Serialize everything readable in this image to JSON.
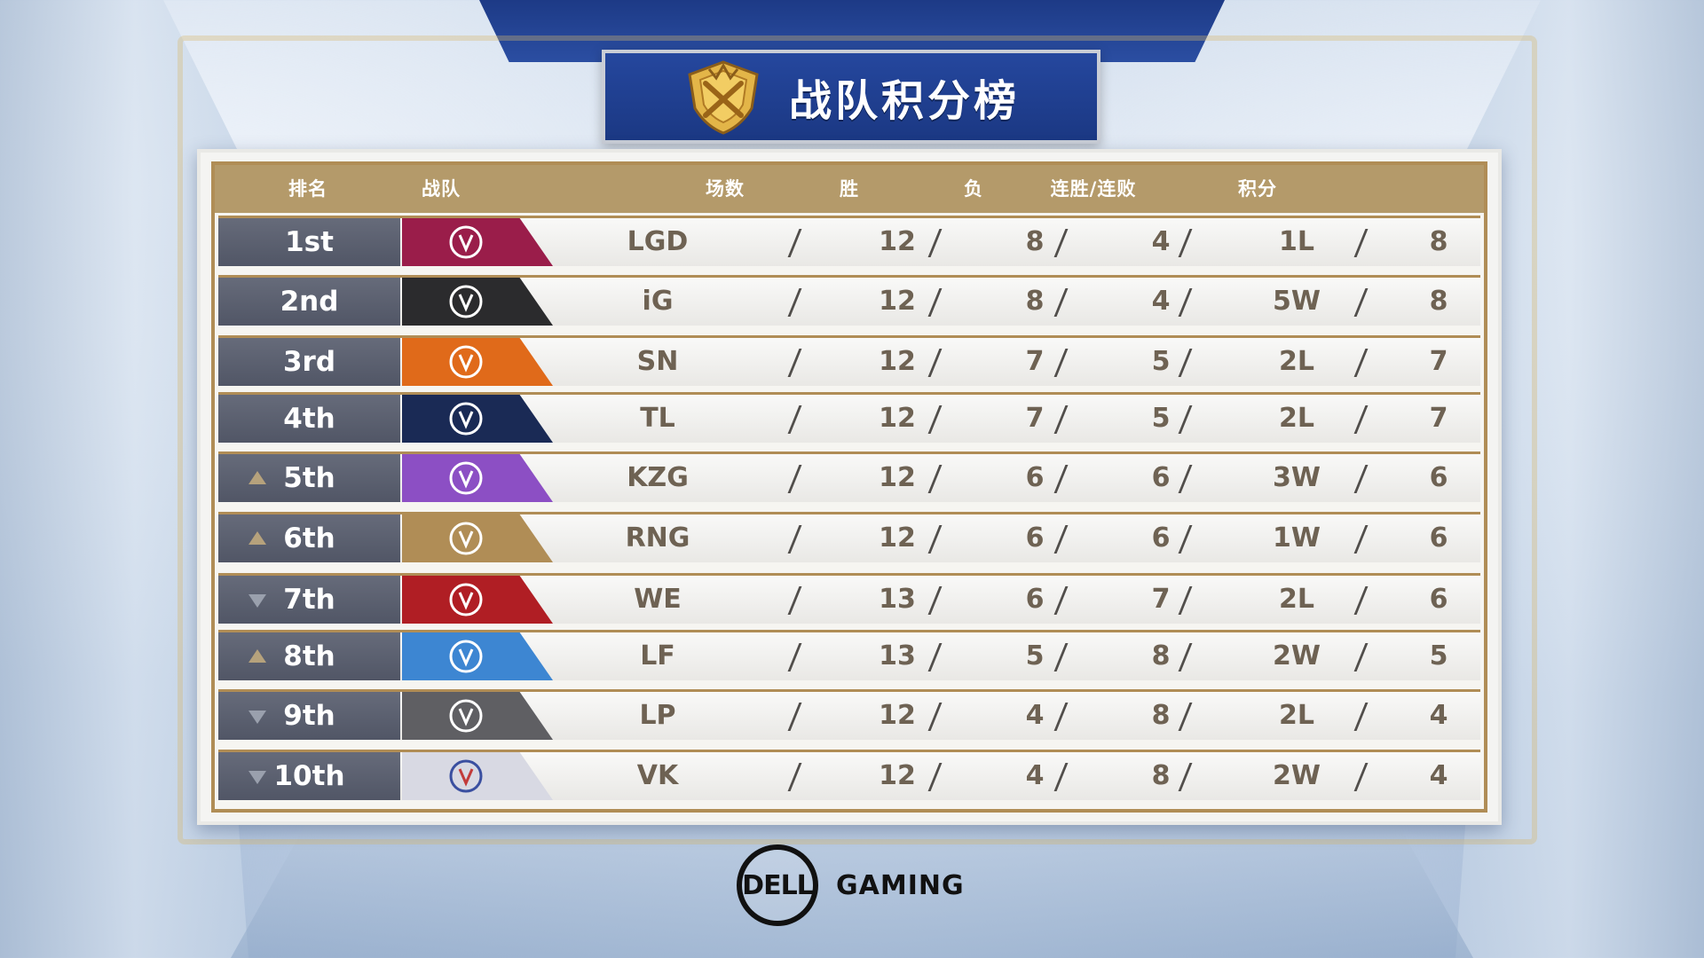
{
  "title": "战队积分榜",
  "headers": {
    "rank": "排名",
    "team": "战队",
    "played": "场数",
    "wins": "胜",
    "losses": "负",
    "streak": "连胜/连败",
    "points": "积分"
  },
  "rows": [
    {
      "rank": "1st",
      "trend": "none",
      "team": "LGD",
      "logo_color": "#9a1d4a",
      "played": "12",
      "wins": "8",
      "losses": "4",
      "streak": "1L",
      "points": "8"
    },
    {
      "rank": "2nd",
      "trend": "none",
      "team": "iG",
      "logo_color": "#2b2b2d",
      "played": "12",
      "wins": "8",
      "losses": "4",
      "streak": "5W",
      "points": "8"
    },
    {
      "rank": "3rd",
      "trend": "none",
      "team": "SN",
      "logo_color": "#e06a1a",
      "played": "12",
      "wins": "7",
      "losses": "5",
      "streak": "2L",
      "points": "7"
    },
    {
      "rank": "4th",
      "trend": "none",
      "team": "TL",
      "logo_color": "#1a2a55",
      "played": "12",
      "wins": "7",
      "losses": "5",
      "streak": "2L",
      "points": "7"
    },
    {
      "rank": "5th",
      "trend": "up",
      "team": "KZG",
      "logo_color": "#8c4fc4",
      "played": "12",
      "wins": "6",
      "losses": "6",
      "streak": "3W",
      "points": "6"
    },
    {
      "rank": "6th",
      "trend": "up",
      "team": "RNG",
      "logo_color": "#b08d56",
      "played": "12",
      "wins": "6",
      "losses": "6",
      "streak": "1W",
      "points": "6"
    },
    {
      "rank": "7th",
      "trend": "down",
      "team": "WE",
      "logo_color": "#b01e24",
      "played": "13",
      "wins": "6",
      "losses": "7",
      "streak": "2L",
      "points": "6"
    },
    {
      "rank": "8th",
      "trend": "up",
      "team": "LF",
      "logo_color": "#3d86d2",
      "played": "13",
      "wins": "5",
      "losses": "8",
      "streak": "2W",
      "points": "5"
    },
    {
      "rank": "9th",
      "trend": "down",
      "team": "LP",
      "logo_color": "#5f5f63",
      "played": "12",
      "wins": "4",
      "losses": "8",
      "streak": "2L",
      "points": "4"
    },
    {
      "rank": "10th",
      "trend": "down",
      "team": "VK",
      "logo_color": "#d8d9e3",
      "played": "12",
      "wins": "4",
      "losses": "8",
      "streak": "2W",
      "points": "4"
    }
  ],
  "sponsor": {
    "logo_text": "DΕLL",
    "label": "GAMING"
  }
}
